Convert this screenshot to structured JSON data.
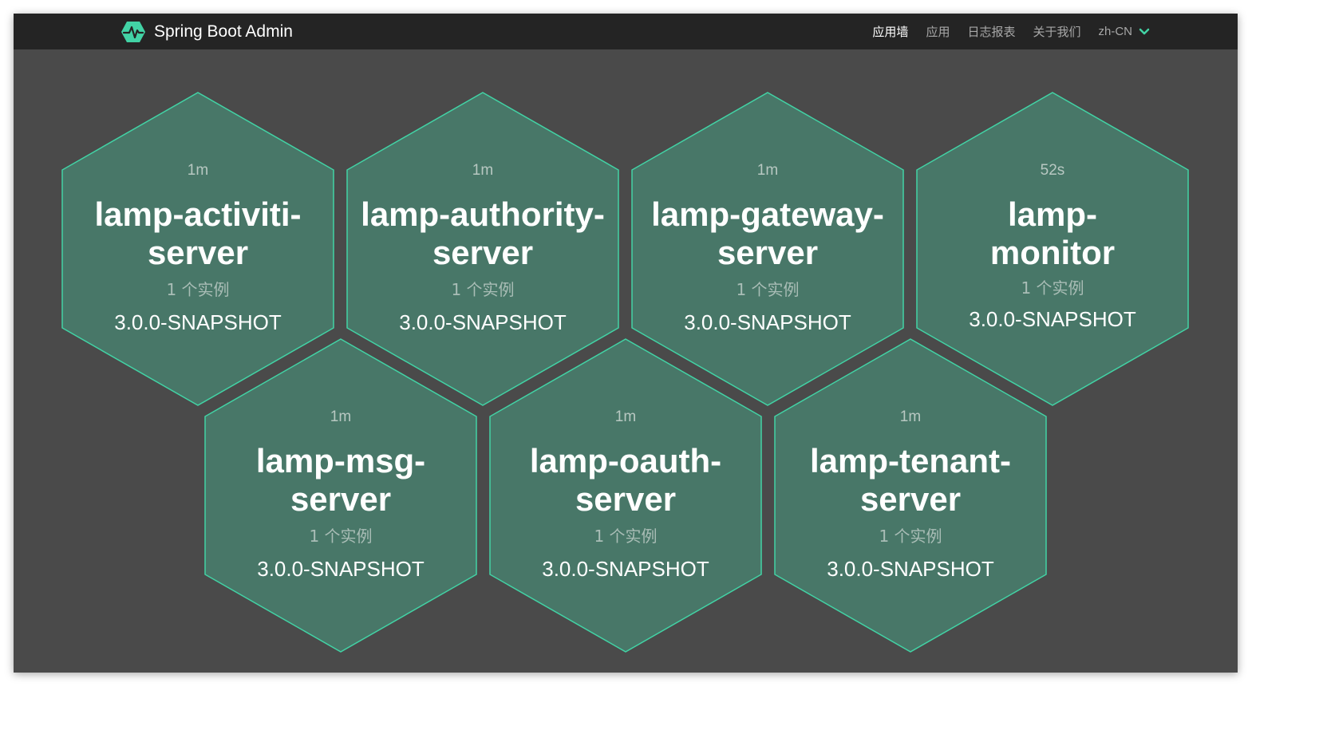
{
  "brand": {
    "title": "Spring Boot Admin",
    "icon": "heartbeat-hexagon-icon",
    "accent": "#42d3a5"
  },
  "nav": {
    "items": [
      {
        "label": "应用墙",
        "active": true
      },
      {
        "label": "应用",
        "active": false
      },
      {
        "label": "日志报表",
        "active": false
      },
      {
        "label": "关于我们",
        "active": false
      }
    ],
    "language": "zh-CN"
  },
  "colors": {
    "hex_fill": "#487768",
    "hex_stroke": "#42d3a5",
    "background": "#4a4a4a",
    "navbar": "#242424"
  },
  "applications": [
    {
      "since": "1m",
      "name": "lamp-activiti-\nserver",
      "instances": "1 个实例",
      "version": "3.0.0-SNAPSHOT"
    },
    {
      "since": "1m",
      "name": "lamp-authority-\nserver",
      "instances": "1 个实例",
      "version": "3.0.0-SNAPSHOT"
    },
    {
      "since": "1m",
      "name": "lamp-gateway-\nserver",
      "instances": "1 个实例",
      "version": "3.0.0-SNAPSHOT"
    },
    {
      "since": "52s",
      "name": "lamp-\nmonitor",
      "instances": "1 个实例",
      "version": "3.0.0-SNAPSHOT"
    },
    {
      "since": "1m",
      "name": "lamp-msg-\nserver",
      "instances": "1 个实例",
      "version": "3.0.0-SNAPSHOT"
    },
    {
      "since": "1m",
      "name": "lamp-oauth-\nserver",
      "instances": "1 个实例",
      "version": "3.0.0-SNAPSHOT"
    },
    {
      "since": "1m",
      "name": "lamp-tenant-\nserver",
      "instances": "1 个实例",
      "version": "3.0.0-SNAPSHOT"
    }
  ]
}
